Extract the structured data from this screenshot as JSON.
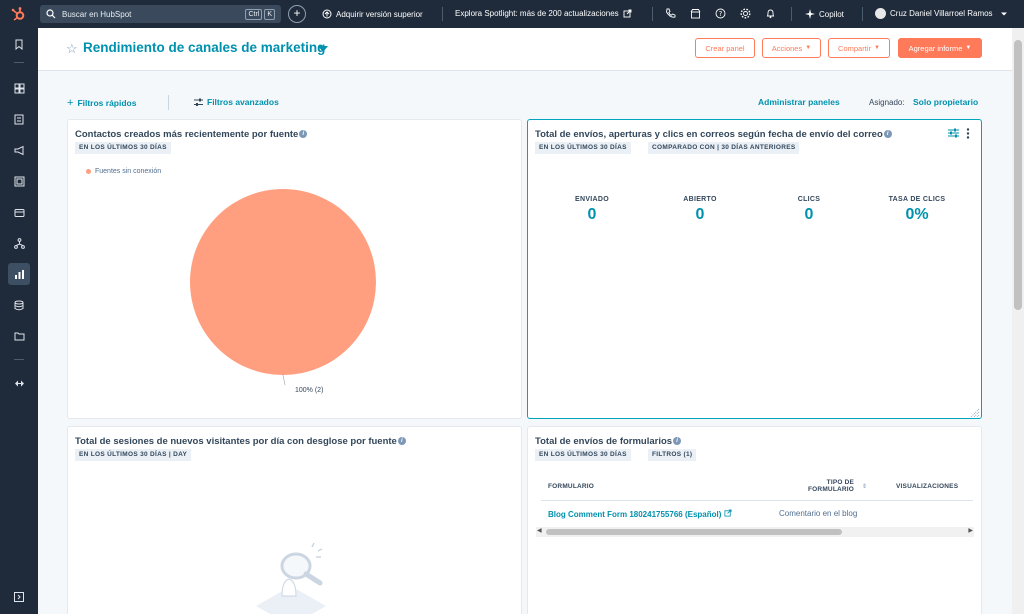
{
  "topnav": {
    "search_placeholder": "Buscar en HubSpot",
    "shortcut_ctrl": "Ctrl",
    "shortcut_k": "K",
    "upgrade": "Adquirir versión superior",
    "spotlight": "Explora Spotlight: más de 200 actualizaciones",
    "copilot": "Copilot",
    "user_name": "Cruz Daniel Villarroel Ramos",
    "brand_color": "#ff7a59"
  },
  "header": {
    "title": "Rendimiento de canales de marketing",
    "buttons": {
      "create_panel": "Crear panel",
      "actions": "Acciones",
      "share": "Compartir",
      "add_report": "Agregar informe"
    }
  },
  "filters": {
    "quick": "Filtros rápidos",
    "advanced": "Filtros avanzados",
    "manage": "Administrar paneles",
    "assigned_label": "Asignado:",
    "assigned_value": "Solo propietario"
  },
  "cards": {
    "contacts": {
      "title": "Contactos creados más recientemente por fuente",
      "tag": "EN LOS ÚLTIMOS 30 DÍAS",
      "chart_data": {
        "type": "pie",
        "categories": [
          "Fuentes sin conexión"
        ],
        "values": [
          2
        ],
        "percent_labels": [
          "100% (2)"
        ],
        "colors": [
          "#ff9f80"
        ]
      }
    },
    "emails": {
      "title": "Total de envíos, aperturas y clics en correos según fecha de envío del correo",
      "tag1": "EN LOS ÚLTIMOS 30 DÍAS",
      "tag2": "COMPARADO CON | 30 DÍAS ANTERIORES",
      "kpis": [
        {
          "label": "ENVIADO",
          "value": "0"
        },
        {
          "label": "ABIERTO",
          "value": "0"
        },
        {
          "label": "CLICS",
          "value": "0"
        },
        {
          "label": "TASA DE CLICS",
          "value": "0%"
        }
      ]
    },
    "sessions": {
      "title": "Total de sesiones de nuevos visitantes por día con desglose por fuente",
      "tag": "EN LOS ÚLTIMOS 30 DÍAS | DAY"
    },
    "forms": {
      "title": "Total de envíos de formularios",
      "tag1": "EN LOS ÚLTIMOS 30 DÍAS",
      "tag2": "FILTROS (1)",
      "columns": {
        "form": "FORMULARIO",
        "type_line1": "TIPO DE",
        "type_line2": "FORMULARIO",
        "views": "VISUALIZACIONES"
      },
      "rows": [
        {
          "form": "Blog Comment Form 180241755766 (Español)",
          "type": "Comentario en el blog"
        }
      ]
    }
  }
}
